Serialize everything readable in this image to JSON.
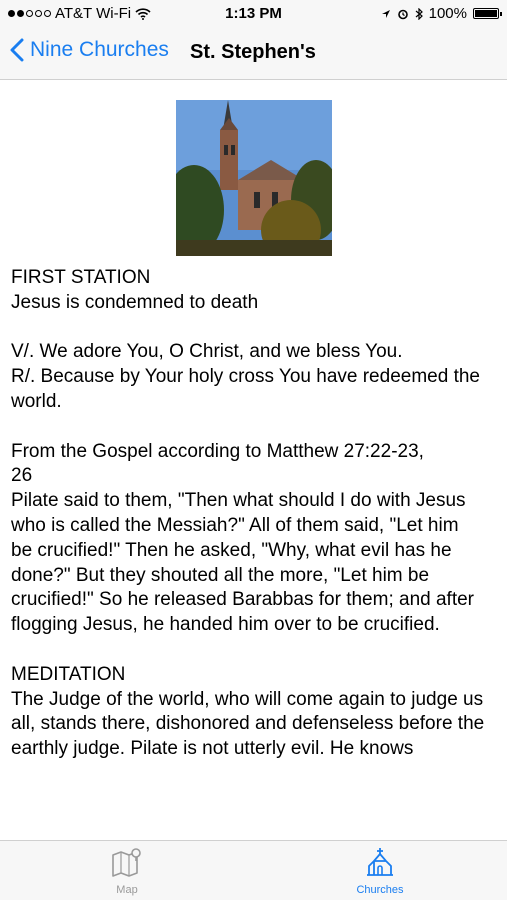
{
  "status_bar": {
    "carrier": "AT&T Wi-Fi",
    "time": "1:13 PM",
    "battery": "100%"
  },
  "nav": {
    "back_label": "Nine Churches",
    "title": "St. Stephen's"
  },
  "content": {
    "station_heading": "FIRST STATION",
    "station_title": "Jesus is condemned to death",
    "versicle": "V/. We adore You, O Christ, and we bless You.",
    "response": "R/. Because by Your holy cross You have redeemed the world.",
    "gospel_ref_line1": "From the Gospel according to Matthew 27:22-23,",
    "gospel_ref_line2": "26",
    "gospel_text_1": "Pilate said to them, \"Then what should I do with Jesus who is called the Messiah?\" All of them said, \"Let him",
    "gospel_text_2": "be crucified!\" Then he asked, \"Why, what evil has he done?\" But they shouted all the more, \"Let him be crucified!\" So he released Barabbas for them; and after flogging Jesus, he handed him over to be crucified.",
    "meditation_heading": "MEDITATION",
    "meditation_text_1": "The Judge of the world, who will come again to judge us all, stands there, dishonored and defenseless before the",
    "meditation_text_2": "earthly judge. Pilate is not utterly evil. He knows"
  },
  "tab_bar": {
    "tabs": [
      {
        "label": "Map",
        "icon": "map-icon",
        "color": "#9a9a9a"
      },
      {
        "label": "Churches",
        "icon": "church-icon",
        "color": "#1a7ef0"
      }
    ]
  },
  "colors": {
    "accent": "#1a7ef0",
    "inactive": "#9a9a9a",
    "bar_background": "#f7f7f7"
  }
}
